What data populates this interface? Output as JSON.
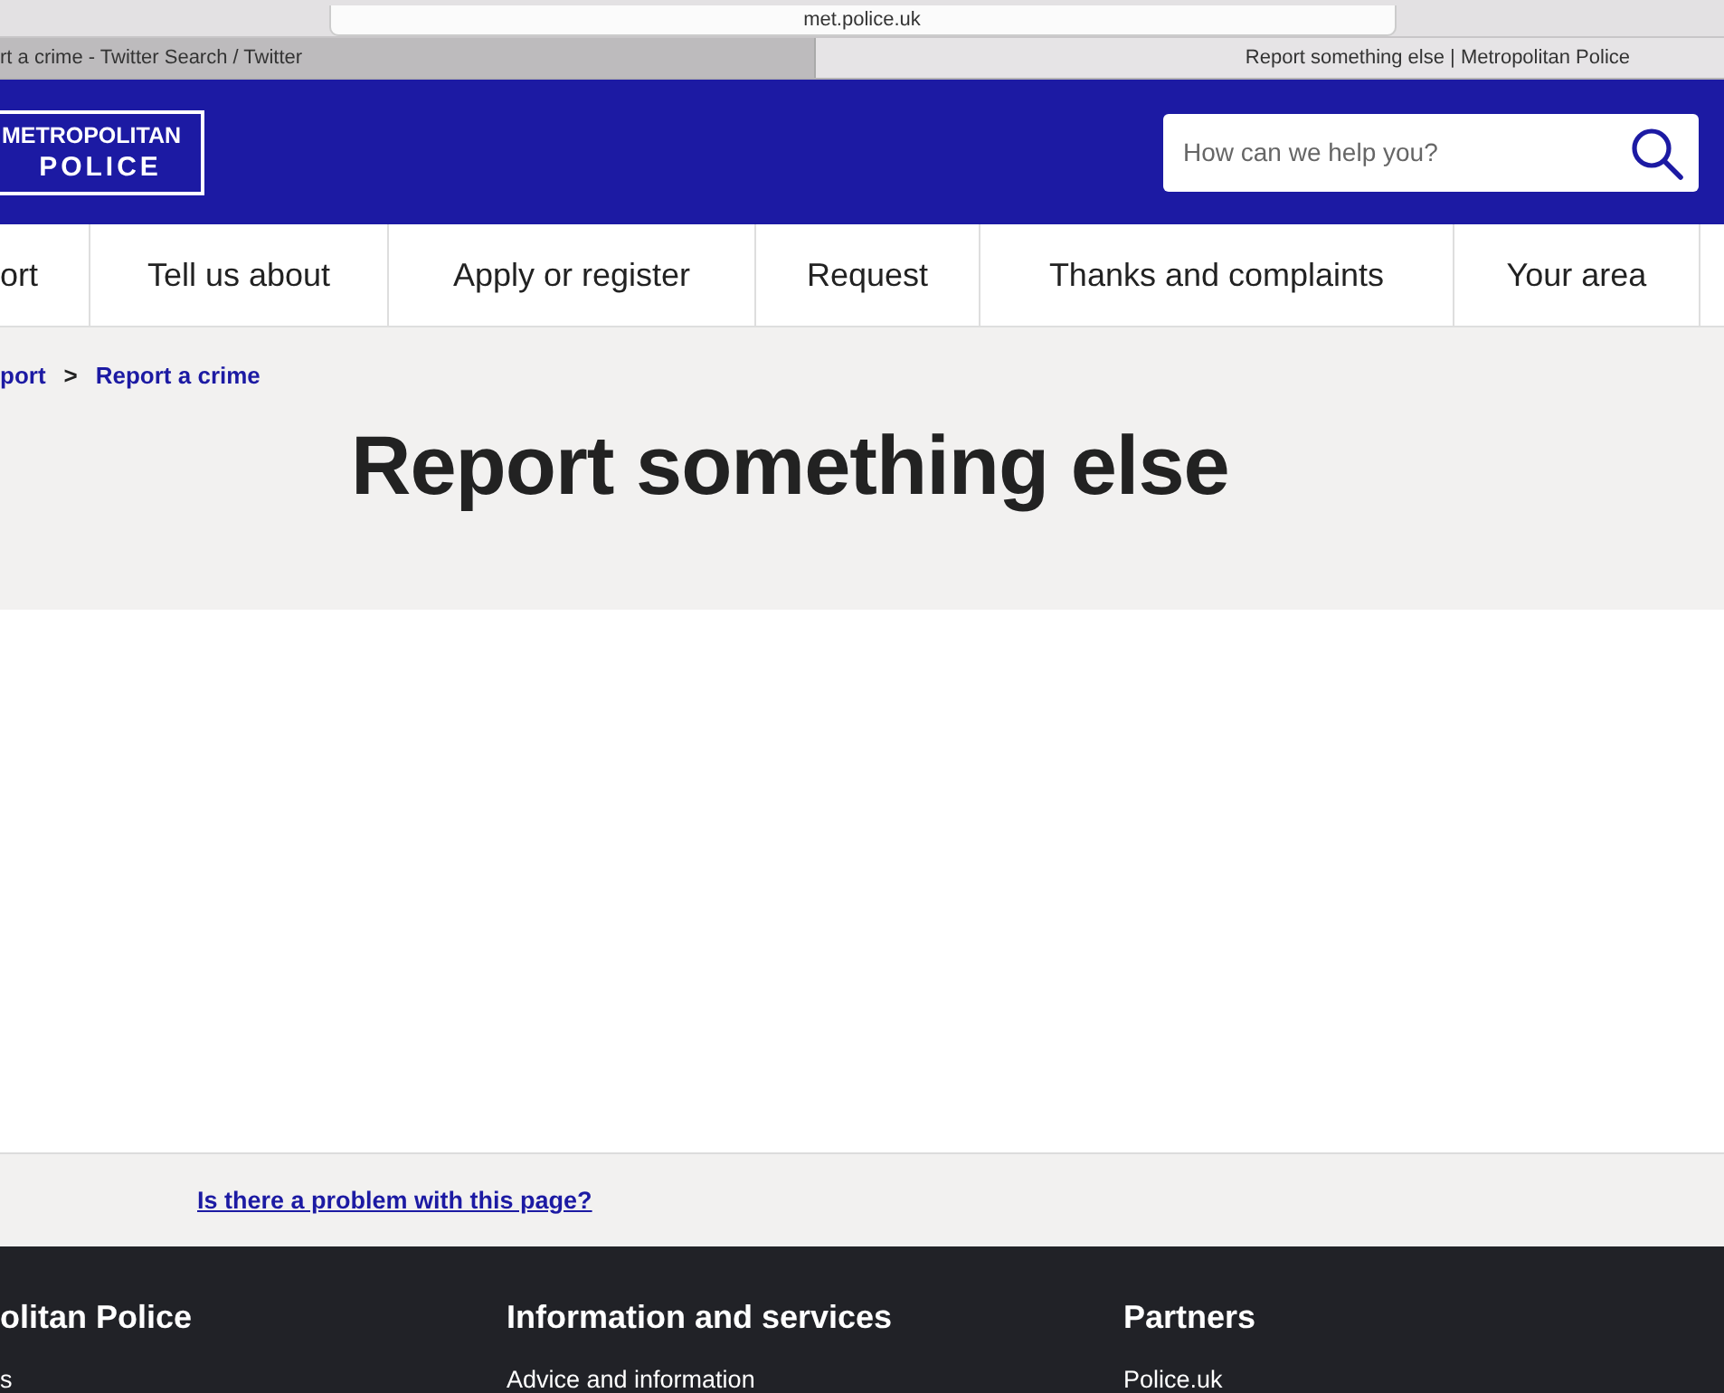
{
  "browser": {
    "address": "met.police.uk",
    "tabs": [
      {
        "title": "rt a crime - Twitter Search / Twitter",
        "selected": false
      },
      {
        "title": "Report something else | Metropolitan Police",
        "selected": true
      }
    ]
  },
  "header": {
    "logo": [
      "METROPOLITAN",
      "POLICE"
    ],
    "search": {
      "placeholder": "How can we help you?"
    }
  },
  "nav": {
    "items": [
      "ort",
      "Tell us about",
      "Apply or register",
      "Request",
      "Thanks and complaints",
      "Your area"
    ]
  },
  "breadcrumb": {
    "separator": ">",
    "items": [
      "port",
      "Report a crime"
    ]
  },
  "page": {
    "title": "Report something else"
  },
  "feedback": {
    "link": "Is there a problem with this page?"
  },
  "footer": {
    "columns": [
      {
        "heading": "olitan Police",
        "links": [
          "s"
        ]
      },
      {
        "heading": "Information and services",
        "links": [
          "Advice and information"
        ]
      },
      {
        "heading": "Partners",
        "links": [
          "Police.uk"
        ]
      }
    ]
  }
}
